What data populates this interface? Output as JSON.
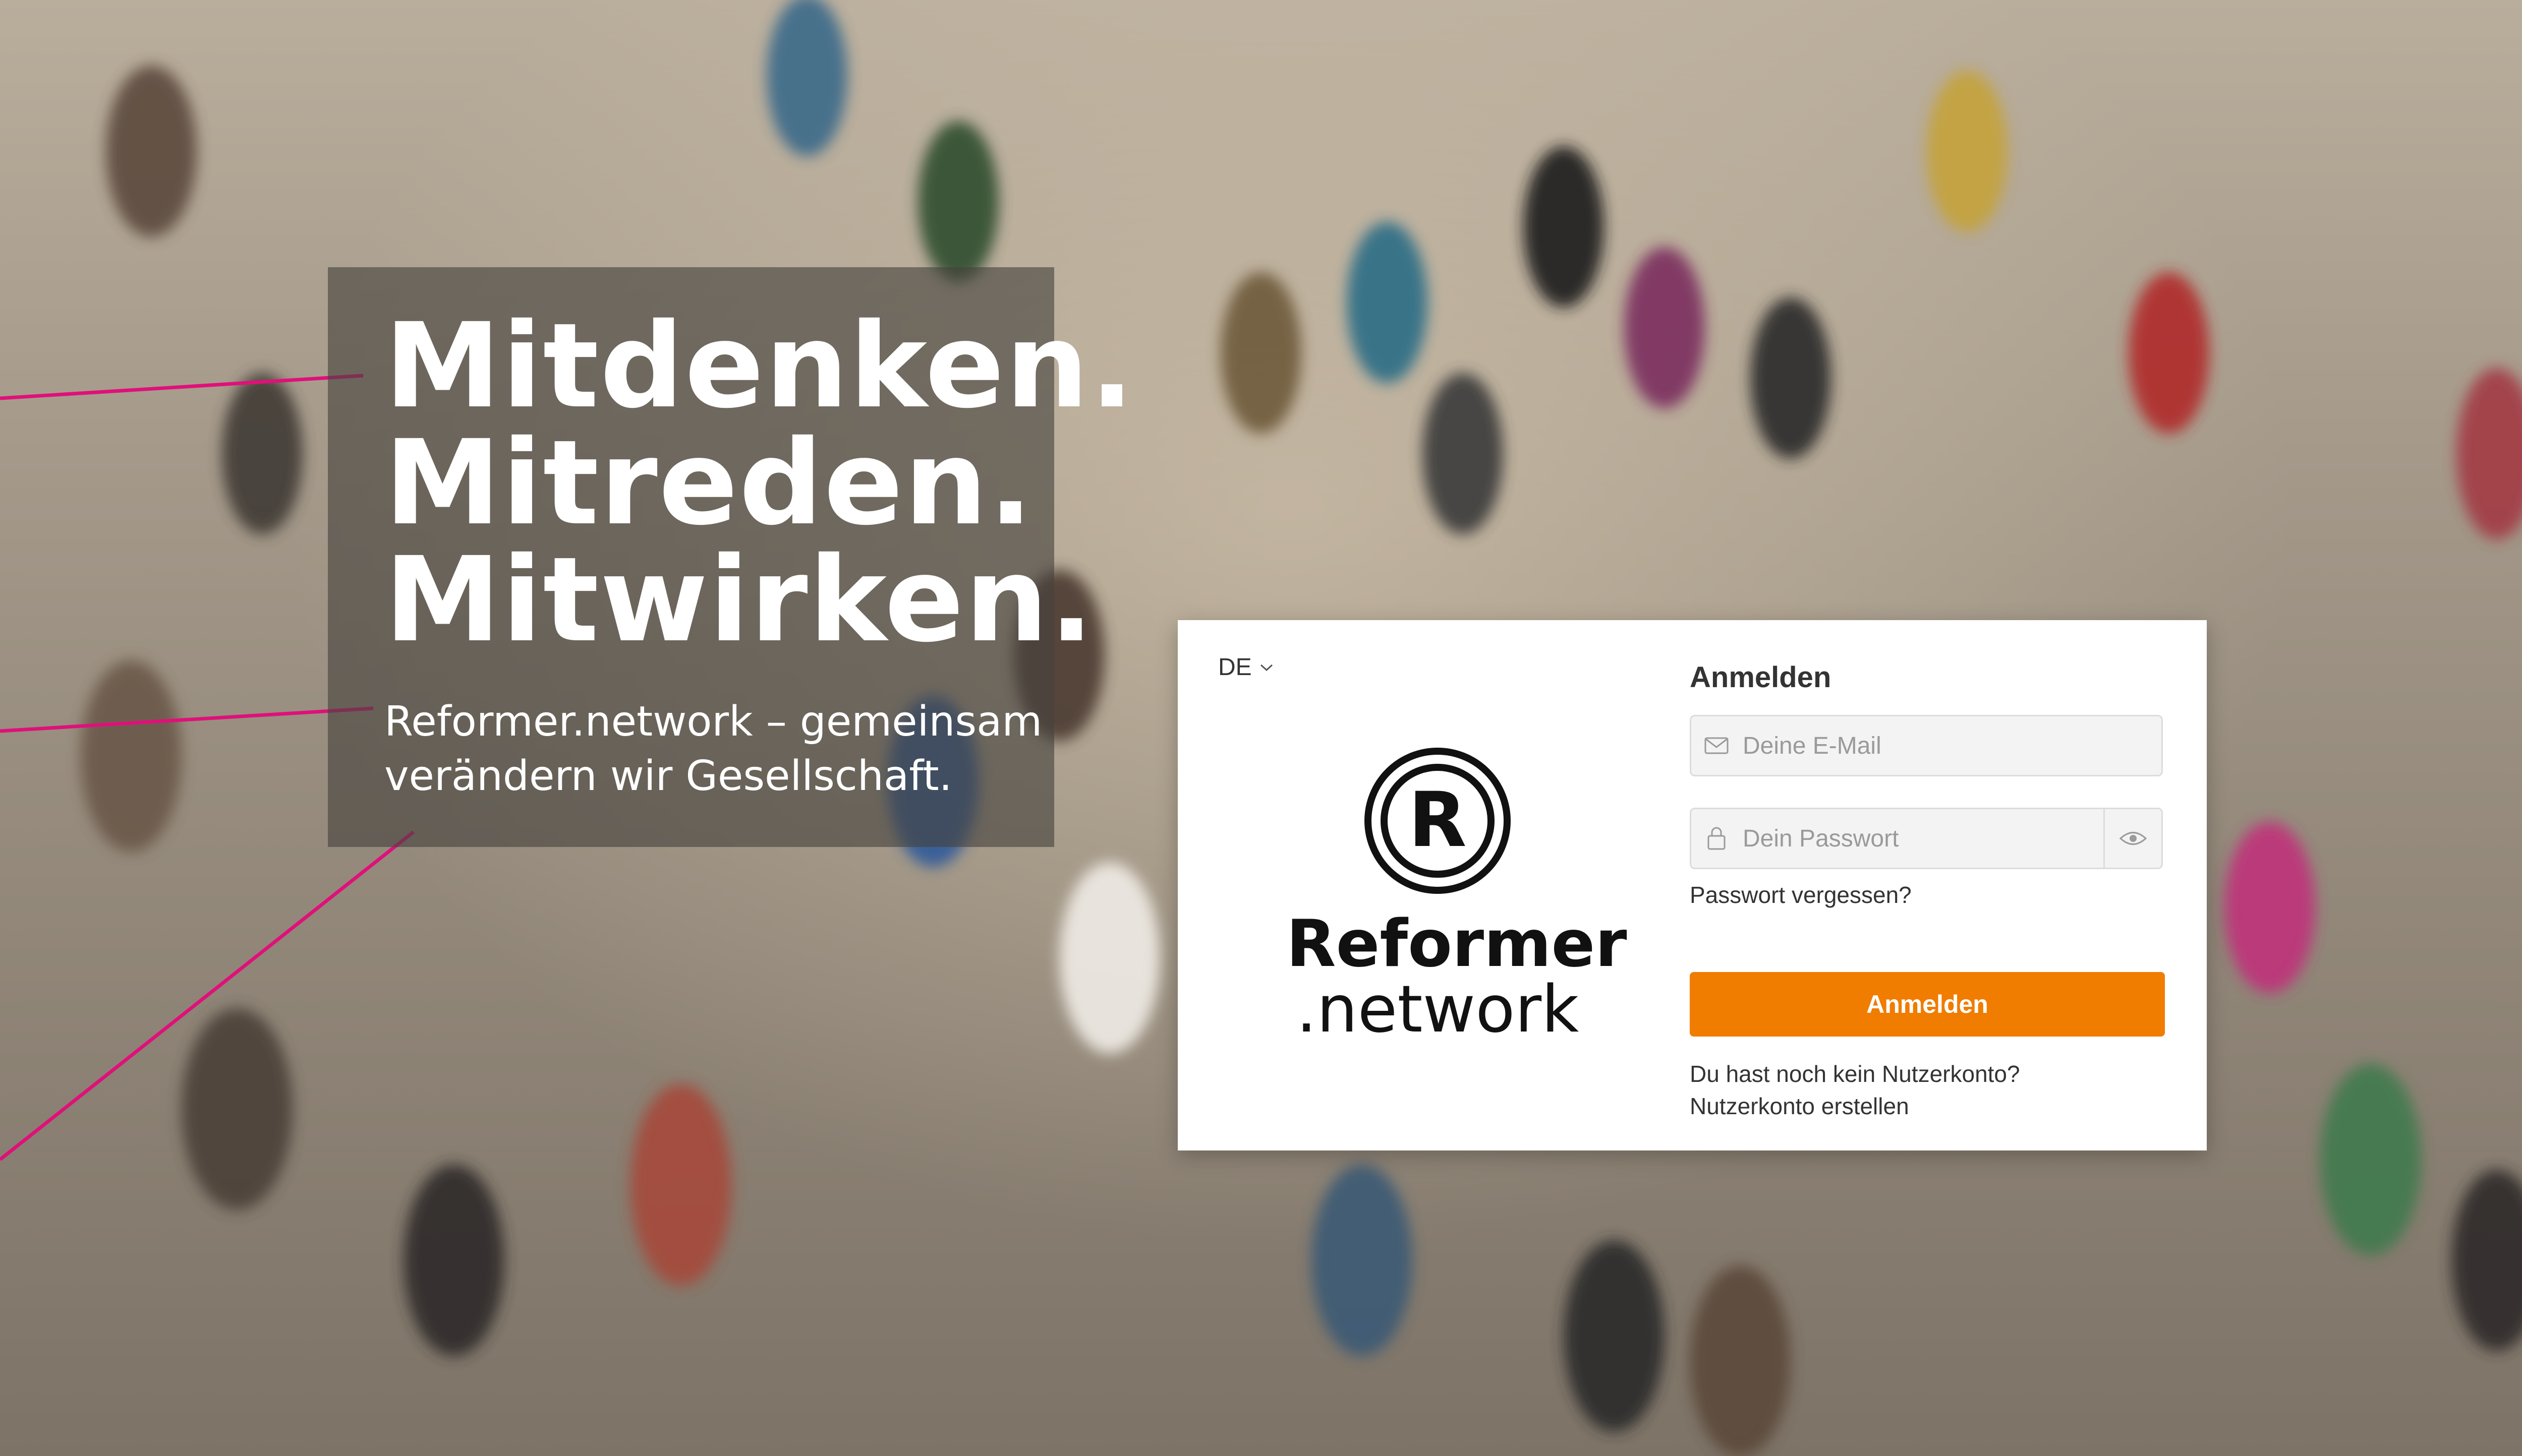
{
  "hero": {
    "headline": [
      "Mitdenken.",
      "Mitreden.",
      "Mitwirken."
    ],
    "subline": [
      "Reformer.network – gemeinsam",
      "verändern wir Gesellschaft."
    ]
  },
  "colors": {
    "accent_line": "#e0107a",
    "button": "#f07c00",
    "overlay": "#46423e"
  },
  "language": {
    "selected": "DE",
    "icon": "chevron-down-icon"
  },
  "logo": {
    "line1": "Reformer",
    "line2": ".network",
    "mark": "R"
  },
  "login": {
    "title": "Anmelden",
    "email_placeholder": "Deine E-Mail",
    "email_value": "",
    "password_placeholder": "Dein Passwort",
    "password_value": "",
    "forgot_label": "Passwort vergessen?",
    "submit_label": "Anmelden",
    "no_account_text": "Du hast noch kein Nutzerkonto?",
    "create_account_label": "Nutzerkonto erstellen"
  },
  "icons": {
    "email": "mail-icon",
    "password": "lock-icon",
    "reveal": "eye-icon"
  }
}
